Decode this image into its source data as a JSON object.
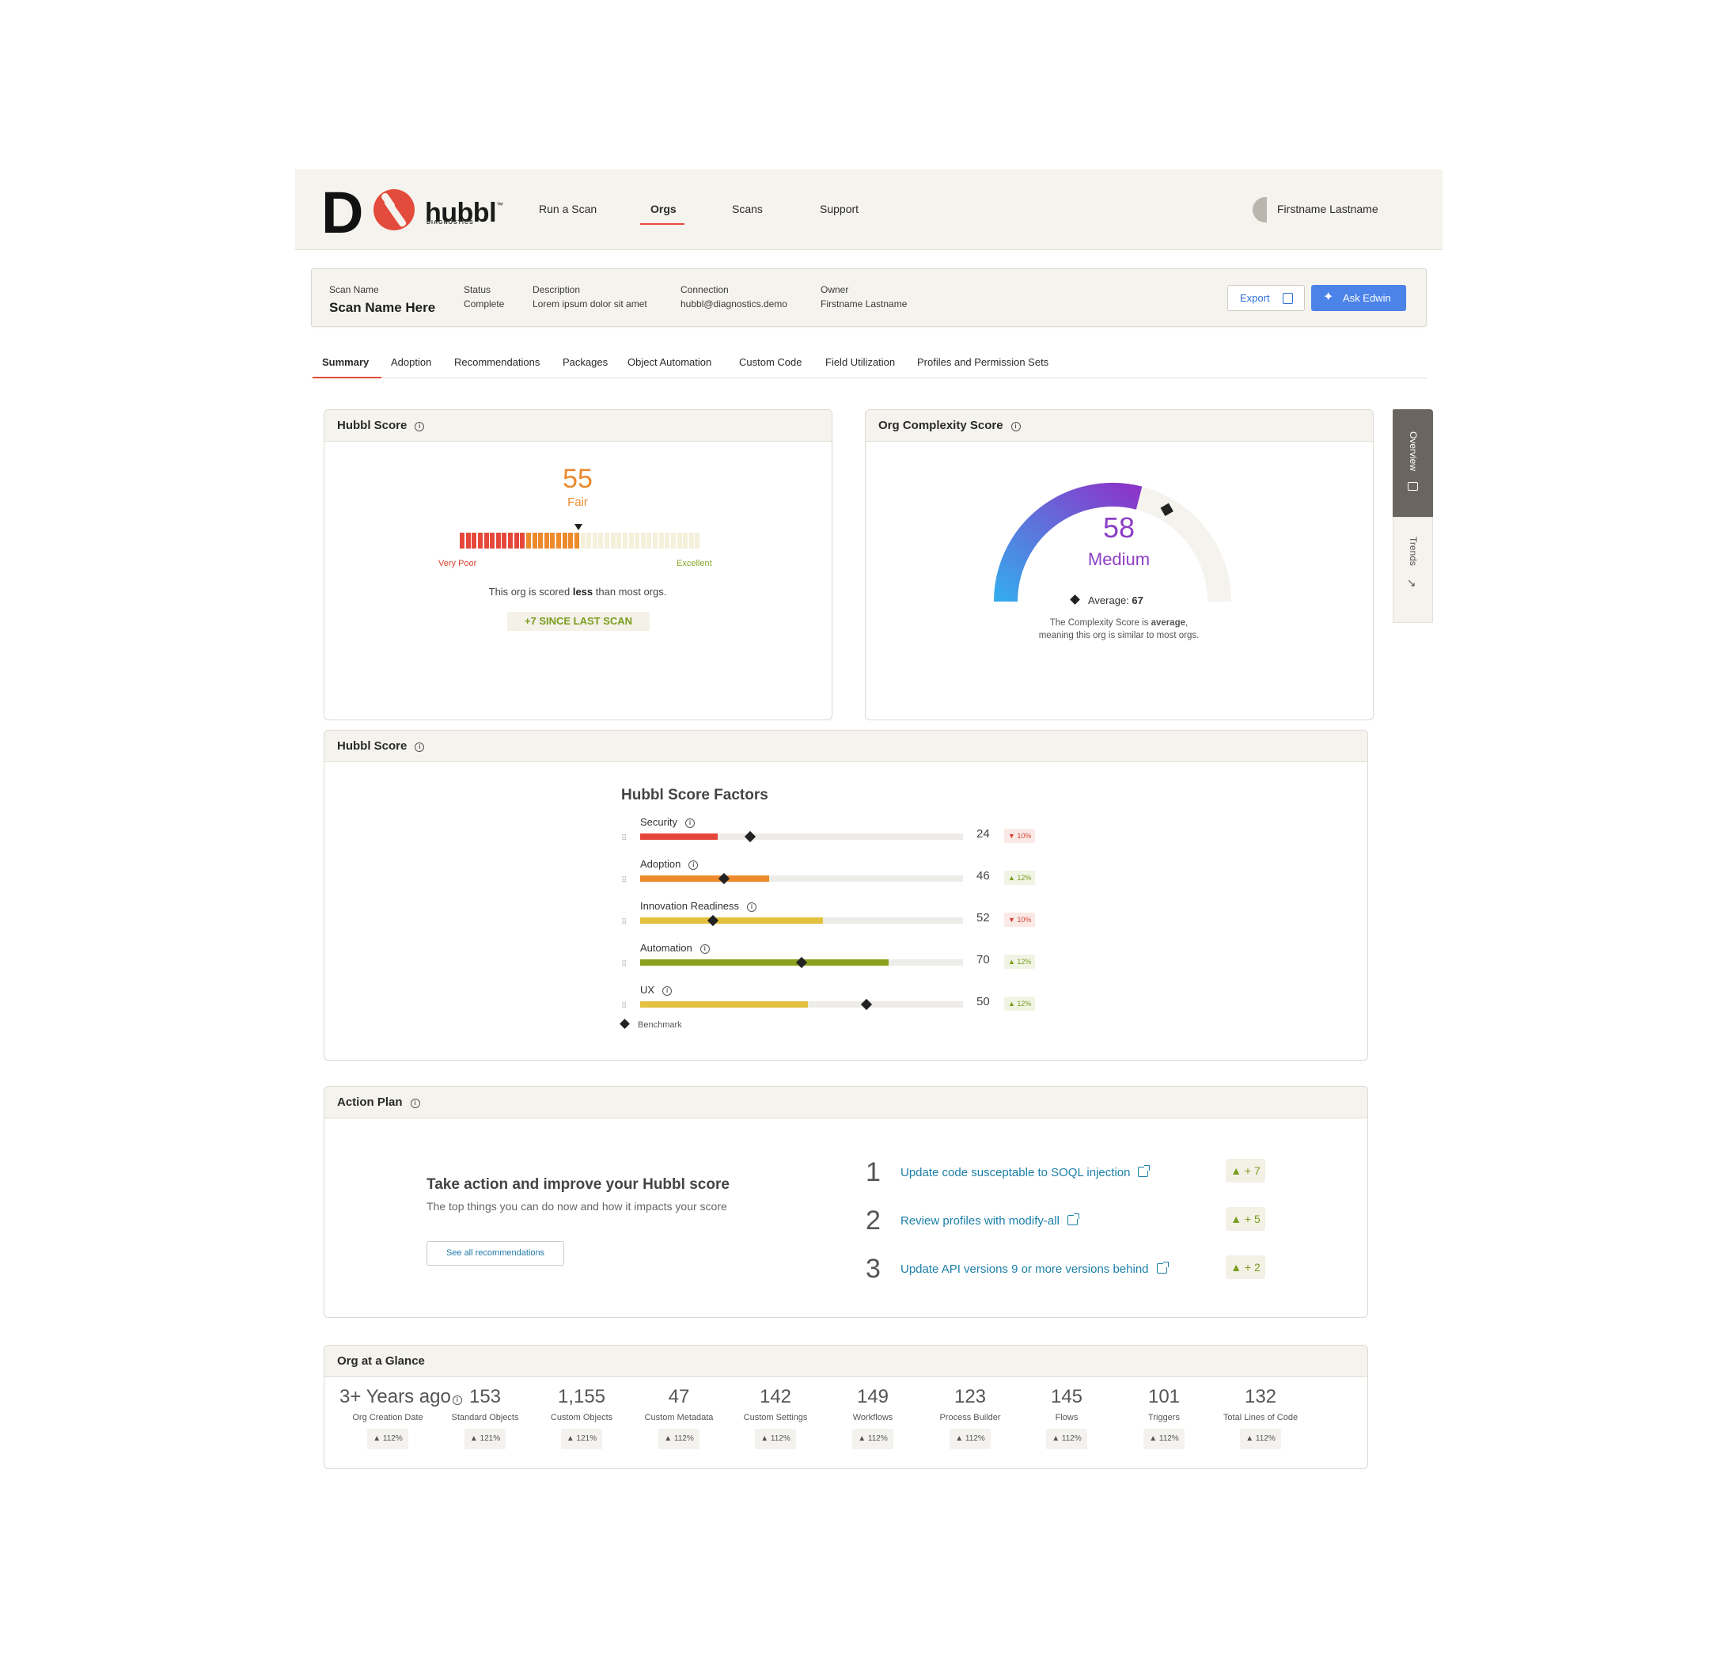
{
  "brand": {
    "letter": "D",
    "name": "hubbl",
    "tm": "™",
    "sub": "DIAGNOSTICS"
  },
  "nav": {
    "items": [
      "Run a Scan",
      "Orgs",
      "Scans",
      "Support"
    ],
    "active": "Orgs"
  },
  "user": {
    "name": "Firstname Lastname"
  },
  "scan": {
    "name_label": "Scan Name",
    "name_value": "Scan Name Here",
    "status_label": "Status",
    "status_value": "Complete",
    "description_label": "Description",
    "description_value": "Lorem ipsum dolor sit amet",
    "connection_label": "Connection",
    "connection_value": "hubbl@diagnostics.demo",
    "owner_label": "Owner",
    "owner_value": "Firstname Lastname",
    "export_label": "Export",
    "ask_label": "Ask Edwin"
  },
  "tabs": [
    "Summary",
    "Adoption",
    "Recommendations",
    "Packages",
    "Object Automation",
    "Custom Code",
    "Field Utilization",
    "Profiles and Permission Sets"
  ],
  "hubbl_score": {
    "title": "Hubbl Score",
    "score": "55",
    "rating": "Fair",
    "segments_total": 40,
    "segments_filled": 20,
    "scale_low": "Very Poor",
    "scale_high": "Excellent",
    "desc_pre": "This org is scored ",
    "desc_bold": "less",
    "desc_post": " than most orgs.",
    "since": "+7 SINCE LAST SCAN",
    "colors": {
      "low": "#e5483b",
      "mid": "#ec8a2c",
      "empty": "#f4f0d9"
    }
  },
  "complexity": {
    "title": "Org Complexity Score",
    "score": "58",
    "rating": "Medium",
    "value_fraction": 0.58,
    "average_fraction": 0.67,
    "average_label": "Average: ",
    "average_value": "67",
    "desc_pre": "The Complexity Score is ",
    "desc_bold": "average",
    "desc_post": ",",
    "desc_line2": "meaning this org is similar to most orgs.",
    "colors": {
      "start": "#36a9ec",
      "end": "#8a36c9",
      "track": "#f5f3ee"
    }
  },
  "side_tabs": {
    "overview": "Overview",
    "trends": "Trends"
  },
  "factors": {
    "card_title": "Hubbl Score",
    "title": "Hubbl Score Factors",
    "legend": "Benchmark",
    "items": [
      {
        "name": "Security",
        "value": "24",
        "fraction": 0.24,
        "benchmark": 0.34,
        "delta": "10%",
        "dir": "down",
        "color": "#e5483b"
      },
      {
        "name": "Adoption",
        "value": "46",
        "fraction": 0.4,
        "benchmark": 0.26,
        "delta": "12%",
        "dir": "up",
        "color": "#ec8a2c"
      },
      {
        "name": "Innovation Readiness",
        "value": "52",
        "fraction": 0.565,
        "benchmark": 0.225,
        "delta": "10%",
        "dir": "down",
        "color": "#e3c13f"
      },
      {
        "name": "Automation",
        "value": "70",
        "fraction": 0.77,
        "benchmark": 0.5,
        "delta": "12%",
        "dir": "up",
        "color": "#8aa11d"
      },
      {
        "name": "UX",
        "value": "50",
        "fraction": 0.52,
        "benchmark": 0.7,
        "delta": "12%",
        "dir": "up",
        "color": "#e3c13f"
      }
    ]
  },
  "action_plan": {
    "title": "Action Plan",
    "heading": "Take action and improve your Hubbl score",
    "sub": "The top things you can do now and how it impacts your score",
    "button": "See all recommendations",
    "items": [
      {
        "num": "1",
        "text": "Update code susceptable to SOQL injection",
        "impact": "▲ + 7"
      },
      {
        "num": "2",
        "text": "Review profiles with modify-all",
        "impact": "▲ + 5"
      },
      {
        "num": "3",
        "text": "Update API versions 9 or more versions behind",
        "impact": "▲ + 2"
      }
    ]
  },
  "glance": {
    "title": "Org at a Glance",
    "items": [
      {
        "value": "3+ Years ago",
        "label": "Org Creation Date",
        "badge": "▲ 112%"
      },
      {
        "value": "153",
        "label": "Standard Objects",
        "badge": "▲ 121%"
      },
      {
        "value": "1,155",
        "label": "Custom Objects",
        "badge": "▲ 121%"
      },
      {
        "value": "47",
        "label": "Custom Metadata",
        "badge": "▲ 112%"
      },
      {
        "value": "142",
        "label": "Custom Settings",
        "badge": "▲ 112%"
      },
      {
        "value": "149",
        "label": "Workflows",
        "badge": "▲ 112%"
      },
      {
        "value": "123",
        "label": "Process Builder",
        "badge": "▲ 112%"
      },
      {
        "value": "145",
        "label": "Flows",
        "badge": "▲ 112%"
      },
      {
        "value": "101",
        "label": "Triggers",
        "badge": "▲ 112%"
      },
      {
        "value": "132",
        "label": "Total Lines of Code",
        "badge": "▲ 112%"
      }
    ]
  }
}
